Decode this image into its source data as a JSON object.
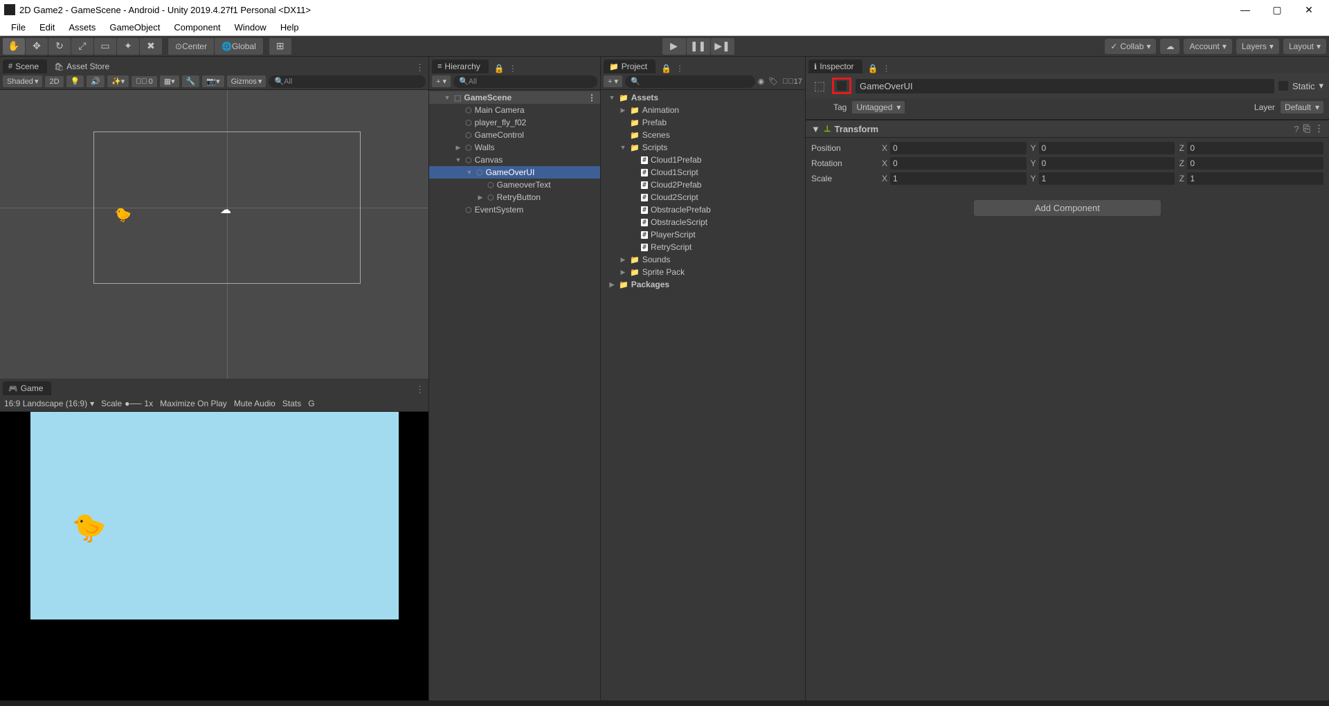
{
  "window": {
    "title": "2D Game2 - GameScene - Android - Unity 2019.4.27f1 Personal <DX11>"
  },
  "menu": [
    "File",
    "Edit",
    "Assets",
    "GameObject",
    "Component",
    "Window",
    "Help"
  ],
  "toolbar": {
    "pivot": "Center",
    "space": "Global",
    "collab": "Collab",
    "account": "Account",
    "layers": "Layers",
    "layout": "Layout"
  },
  "scenePanel": {
    "tab_scene": "Scene",
    "tab_asset_store": "Asset Store",
    "shading": "Shaded",
    "mode_2d": "2D",
    "gizmoCount": "0",
    "gizmos": "Gizmos",
    "search_placeholder": "All"
  },
  "gamePanel": {
    "tab_game": "Game",
    "aspect": "16:9 Landscape (16:9)",
    "scale_label": "Scale",
    "scale_value": "1x",
    "maximize": "Maximize On Play",
    "mute": "Mute Audio",
    "stats": "Stats",
    "giz": "G"
  },
  "hierarchy": {
    "title": "Hierarchy",
    "search": "All",
    "items": [
      {
        "label": "GameScene",
        "type": "scene",
        "exp": "▼",
        "ind": 0
      },
      {
        "label": "Main Camera",
        "type": "go",
        "ind": 1
      },
      {
        "label": "player_fly_f02",
        "type": "go",
        "ind": 1
      },
      {
        "label": "GameControl",
        "type": "go",
        "ind": 1
      },
      {
        "label": "Walls",
        "type": "go",
        "exp": "▶",
        "ind": 1
      },
      {
        "label": "Canvas",
        "type": "go",
        "exp": "▼",
        "ind": 1
      },
      {
        "label": "GameOverUI",
        "type": "go",
        "exp": "▼",
        "ind": 2,
        "sel": true
      },
      {
        "label": "GameoverText",
        "type": "go",
        "ind": 3
      },
      {
        "label": "RetryButton",
        "type": "go",
        "exp": "▶",
        "ind": 3
      },
      {
        "label": "EventSystem",
        "type": "go",
        "ind": 1
      }
    ]
  },
  "project": {
    "title": "Project",
    "hidden_count": "17",
    "items": [
      {
        "label": "Assets",
        "type": "folder",
        "exp": "▼",
        "ind": 0,
        "bold": true
      },
      {
        "label": "Animation",
        "type": "folder",
        "exp": "▶",
        "ind": 1
      },
      {
        "label": "Prefab",
        "type": "folder",
        "ind": 1
      },
      {
        "label": "Scenes",
        "type": "folder",
        "ind": 1
      },
      {
        "label": "Scripts",
        "type": "folder",
        "exp": "▼",
        "ind": 1
      },
      {
        "label": "Cloud1Prefab",
        "type": "script",
        "ind": 2
      },
      {
        "label": "Cloud1Script",
        "type": "script",
        "ind": 2
      },
      {
        "label": "Cloud2Prefab",
        "type": "script",
        "ind": 2
      },
      {
        "label": "Cloud2Script",
        "type": "script",
        "ind": 2
      },
      {
        "label": "ObstraclePrefab",
        "type": "script",
        "ind": 2
      },
      {
        "label": "ObstracleScript",
        "type": "script",
        "ind": 2
      },
      {
        "label": "PlayerScript",
        "type": "script",
        "ind": 2
      },
      {
        "label": "RetryScript",
        "type": "script",
        "ind": 2
      },
      {
        "label": "Sounds",
        "type": "folder",
        "exp": "▶",
        "ind": 1
      },
      {
        "label": "Sprite Pack",
        "type": "folder",
        "exp": "▶",
        "ind": 1
      },
      {
        "label": "Packages",
        "type": "folder",
        "exp": "▶",
        "ind": 0,
        "bold": true
      }
    ]
  },
  "inspector": {
    "title": "Inspector",
    "object_name": "GameOverUI",
    "static_label": "Static",
    "tag_label": "Tag",
    "tag_value": "Untagged",
    "layer_label": "Layer",
    "layer_value": "Default",
    "transform": {
      "title": "Transform",
      "rows": [
        {
          "label": "Position",
          "x": "0",
          "y": "0",
          "z": "0"
        },
        {
          "label": "Rotation",
          "x": "0",
          "y": "0",
          "z": "0"
        },
        {
          "label": "Scale",
          "x": "1",
          "y": "1",
          "z": "1"
        }
      ]
    },
    "add_component": "Add Component"
  }
}
